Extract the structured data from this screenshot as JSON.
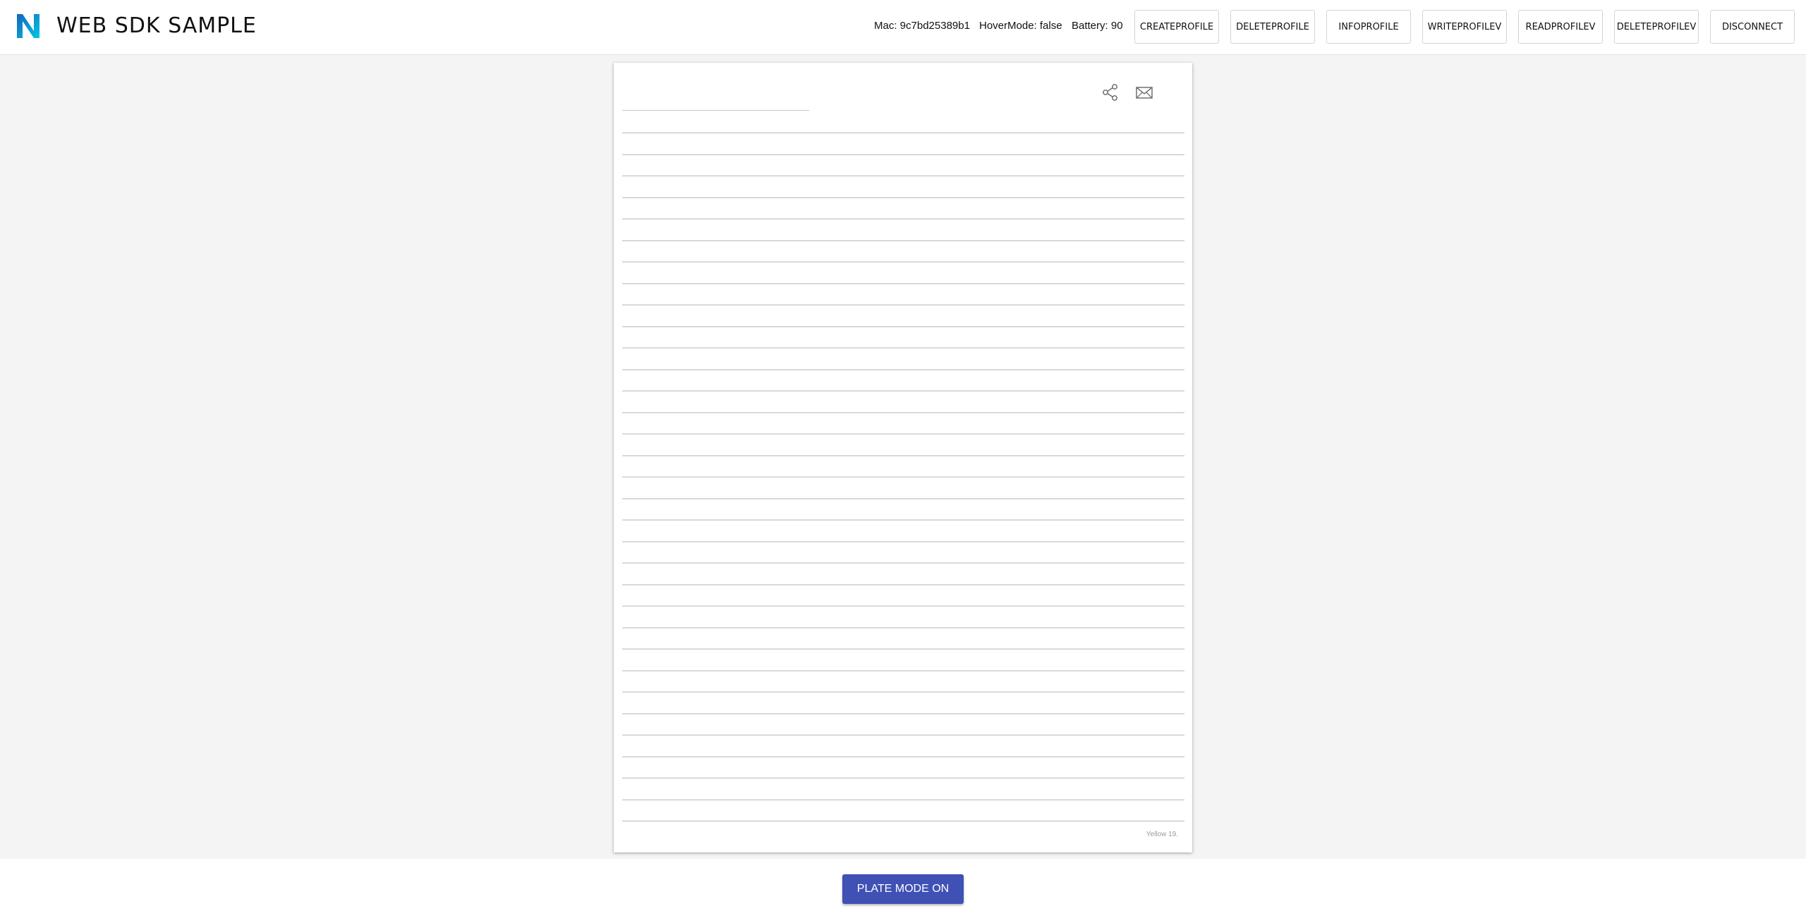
{
  "app": {
    "title": "WEB SDK SAMPLE",
    "logo_icon": "n-logo-icon",
    "logo_colors": [
      "#1976d2",
      "#00bcd4"
    ]
  },
  "status": {
    "mac": "Mac: 9c7bd25389b1",
    "hover_mode": "HoverMode: false",
    "battery": "Battery: 90"
  },
  "toolbar": {
    "buttons": [
      "CREATEPROFILE",
      "DELETEPROFILE",
      "INFOPROFILE",
      "WRITEPROFILEV",
      "READPROFILEV",
      "DELETEPROFILEV",
      "DISCONNECT"
    ]
  },
  "paper": {
    "icons": [
      "share-icon",
      "mail-icon"
    ],
    "footer_label": "Yellow 19."
  },
  "footer": {
    "plate_mode_label": "PLATE MODE ON",
    "accent": "#3f51b5"
  }
}
